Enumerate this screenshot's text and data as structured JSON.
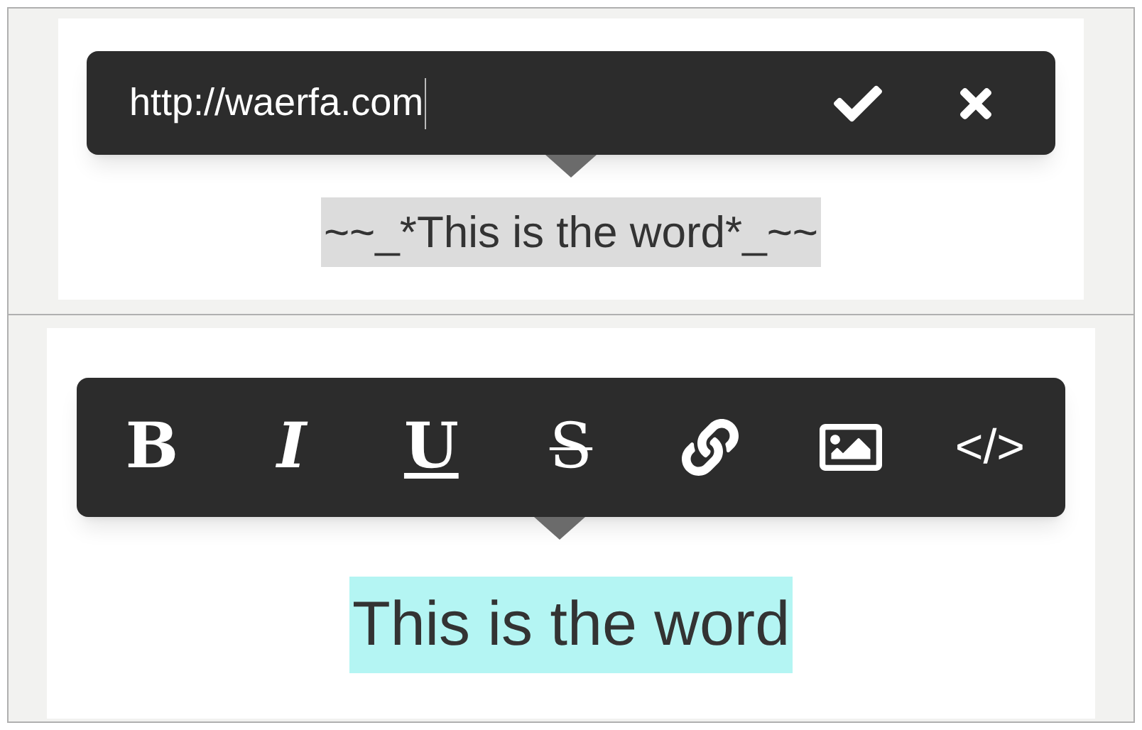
{
  "link_editor": {
    "url_field": {
      "value": "http://waerfa.com"
    },
    "buttons": [
      {
        "kind": "confirm"
      },
      {
        "kind": "cancel"
      }
    ],
    "selected_text": {
      "text": "~~_*This is the word*_~~",
      "color": "#dcdcdc"
    }
  },
  "format_toolbar": {
    "buttons": [
      {
        "kind": "bold",
        "label": "B"
      },
      {
        "kind": "italic",
        "label": "I"
      },
      {
        "kind": "underline",
        "label": "U"
      },
      {
        "kind": "strike",
        "label": "S"
      },
      {
        "kind": "link"
      },
      {
        "kind": "image"
      },
      {
        "kind": "code",
        "label": "</>"
      }
    ],
    "selected_text": {
      "text": "This is the word",
      "color": "#b4f5f3"
    }
  }
}
